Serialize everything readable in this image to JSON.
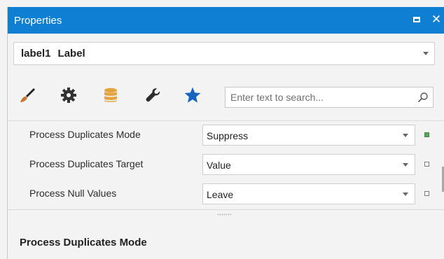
{
  "window": {
    "title": "Properties"
  },
  "object_selector": {
    "name": "label1",
    "type": "Label"
  },
  "toolbar": {
    "tools": [
      {
        "icon": "brush-icon",
        "tooltip": "Appearance"
      },
      {
        "icon": "gear-icon",
        "tooltip": "Behavior"
      },
      {
        "icon": "database-icon",
        "tooltip": "Data"
      },
      {
        "icon": "wrench-icon",
        "tooltip": "Layout"
      },
      {
        "icon": "star-icon",
        "tooltip": "Favorites"
      }
    ],
    "search_placeholder": "Enter text to search..."
  },
  "properties": [
    {
      "label": "Process Duplicates Mode",
      "value": "Suppress",
      "marker": "set"
    },
    {
      "label": "Process Duplicates Target",
      "value": "Value",
      "marker": "default"
    },
    {
      "label": "Process Null Values",
      "value": "Leave",
      "marker": "default"
    }
  ],
  "description": {
    "title": "Process Duplicates Mode"
  },
  "colors": {
    "titlebar": "#0f7fd3",
    "brush": "#b5651d",
    "database": "#e0a030",
    "star": "#1565c0",
    "marker_set": "#5aa55a"
  }
}
